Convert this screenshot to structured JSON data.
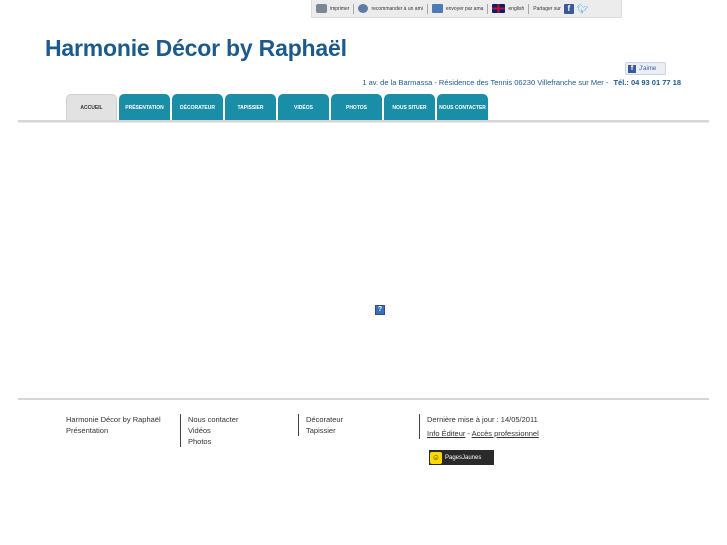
{
  "toolbar": {
    "print_label": "imprimer",
    "recommend_label": "recommander à un ami",
    "email_label": "envoyer par ama",
    "english_label": "english",
    "share_label": "Partager sur"
  },
  "site": {
    "title": "Harmonie Décor by Raphaël",
    "address": "1 av. de la Barmassa - Résidence des Tennis 06230 Villefranche sur Mer  -",
    "tel": "Tél.: 04 93 01 77 18"
  },
  "like": {
    "label": "J'aime"
  },
  "nav": {
    "tabs": [
      {
        "label": "Accueil"
      },
      {
        "label": "Présentation"
      },
      {
        "label": "Décorateur"
      },
      {
        "label": "Tapissier"
      },
      {
        "label": "Vidéos"
      },
      {
        "label": "Photos"
      },
      {
        "label": "Nous situer"
      },
      {
        "label": "Nous contacter"
      }
    ]
  },
  "placeholder": {
    "glyph": "?"
  },
  "footer": {
    "col1": [
      "Harmonie Décor by Raphaël",
      "Présentation"
    ],
    "col2": [
      "Nous contacter",
      "Vidéos",
      "Photos"
    ],
    "col3": [
      "Décorateur",
      "Tapissier"
    ],
    "updated": "Dernière mise à jour : 14/05/2011",
    "info_editeur": "Info Éditeur",
    "link_sep": " - ",
    "acces_pro": "Accès professionnel",
    "pagesjaunes_label": "PagesJaunes"
  },
  "colors": {
    "accent": "#1d5a8c",
    "tab": "#1a8ea6",
    "active_tab": "#e2e2e2"
  },
  "icons": [
    "printer-icon",
    "recommend-icon",
    "email-icon",
    "uk-flag-icon",
    "facebook-icon",
    "twitter-icon"
  ]
}
